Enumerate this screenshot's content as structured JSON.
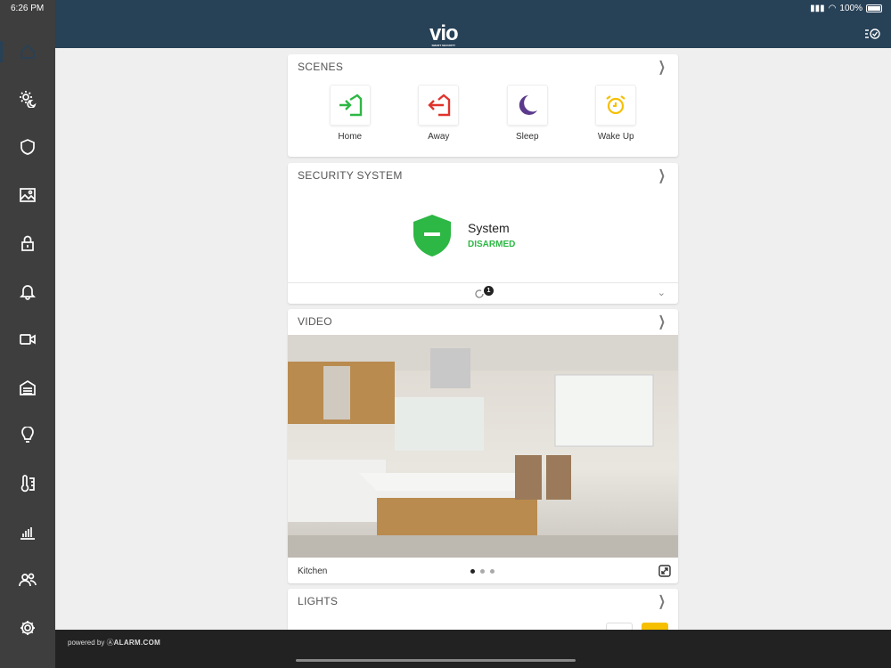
{
  "status": {
    "time": "6:26 PM",
    "battery": "100%"
  },
  "header": {
    "logo": "vio",
    "logo_sub": "SMART SECURITY"
  },
  "sidebar": {
    "items": [
      {
        "icon": "home-icon"
      },
      {
        "icon": "sun-moon-icon"
      },
      {
        "icon": "shield-icon"
      },
      {
        "icon": "image-icon"
      },
      {
        "icon": "lock-icon"
      },
      {
        "icon": "bell-icon"
      },
      {
        "icon": "camera-icon"
      },
      {
        "icon": "garage-icon"
      },
      {
        "icon": "bulb-icon"
      },
      {
        "icon": "thermostat-icon"
      },
      {
        "icon": "chart-icon"
      },
      {
        "icon": "users-icon"
      },
      {
        "icon": "gear-icon"
      }
    ]
  },
  "scenes": {
    "title": "SCENES",
    "items": [
      {
        "label": "Home",
        "color": "#2db744"
      },
      {
        "label": "Away",
        "color": "#e0332b"
      },
      {
        "label": "Sleep",
        "color": "#5b3a8c"
      },
      {
        "label": "Wake Up",
        "color": "#f6c000"
      }
    ]
  },
  "security": {
    "title": "SECURITY SYSTEM",
    "name": "System",
    "state": "DISARMED",
    "badge": "1",
    "color": "#2db744"
  },
  "video": {
    "title": "VIDEO",
    "camera": "Kitchen"
  },
  "lights": {
    "title": "LIGHTS"
  },
  "footer": {
    "powered": "powered by",
    "brand": "ALARM.COM"
  }
}
